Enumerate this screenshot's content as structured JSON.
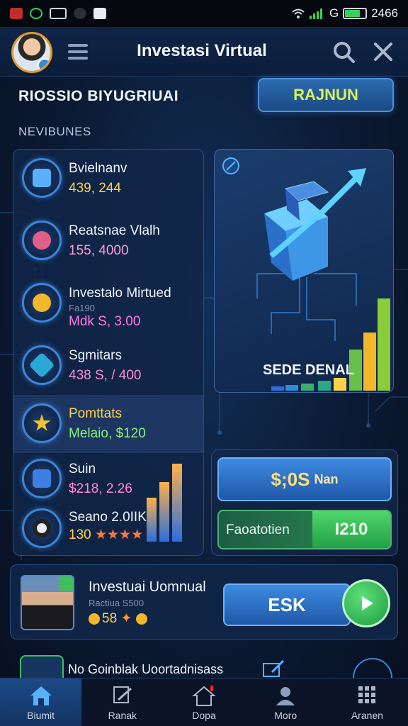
{
  "status_bar": {
    "time": "2466",
    "network": "G"
  },
  "header": {
    "title": "Investasi Virtual"
  },
  "subheader": {
    "title": "RIOSSIO BIYUGRIUAI",
    "button_label": "RAJNUN"
  },
  "section_label": "NEVIBUNES",
  "list": [
    {
      "name": "Bvielnanv",
      "value": "439, 244",
      "value_color": "#ffd24a",
      "icon": "building-icon",
      "sub": ""
    },
    {
      "name": "Reatsnae Vlalh",
      "value": "155, 4000",
      "value_color": "#ff9ad8",
      "icon": "star-badge-icon",
      "sub": ""
    },
    {
      "name": "Investalo Mirtued",
      "value": "Mdk S, 3.00",
      "value_color": "#ff7ae0",
      "icon": "trophy-icon",
      "sub": "Fa190"
    },
    {
      "name": "Sgmitars",
      "value": "438 S, / 400",
      "value_color": "#ff8ad8",
      "icon": "shield-icon",
      "sub": ""
    },
    {
      "name": "Pomttats",
      "value": "Melaio, $120",
      "value_color": "#8af07a",
      "icon": "star-icon",
      "sub": "",
      "name_color": "#ffd24a"
    },
    {
      "name": "Suin",
      "value": "$218, 2.26",
      "value_color": "#ff8ad8",
      "icon": "layers-icon",
      "sub": ""
    },
    {
      "name": "Seano 2.0IIK",
      "value": "130",
      "value_color": "#ffd24a",
      "icon": "vinyl-icon",
      "sub": ""
    }
  ],
  "feature": {
    "label": "SEDE DENAL"
  },
  "side_panel": {
    "amount": "$;0S",
    "amount_suffix": "Nan",
    "stat_label": "Faoatotien",
    "stat_value": "I210"
  },
  "profile": {
    "name": "Investuai Uomnual",
    "sub": "Ractiua S500",
    "stats": "58",
    "ask_label": "ESK"
  },
  "promo": {
    "text": "No Goinblak Uoortadnisass"
  },
  "nav": [
    {
      "label": "Biumit",
      "icon": "home-icon"
    },
    {
      "label": "Ranak",
      "icon": "chart-tool-icon"
    },
    {
      "label": "Dopa",
      "icon": "house-alert-icon"
    },
    {
      "label": "Moro",
      "icon": "user-icon"
    },
    {
      "label": "Aranen",
      "icon": "grid-icon"
    }
  ],
  "colors": {
    "accent": "#3b86d8",
    "gold": "#ffd24a",
    "green": "#3fbf5a",
    "bg": "#0b1a33"
  }
}
